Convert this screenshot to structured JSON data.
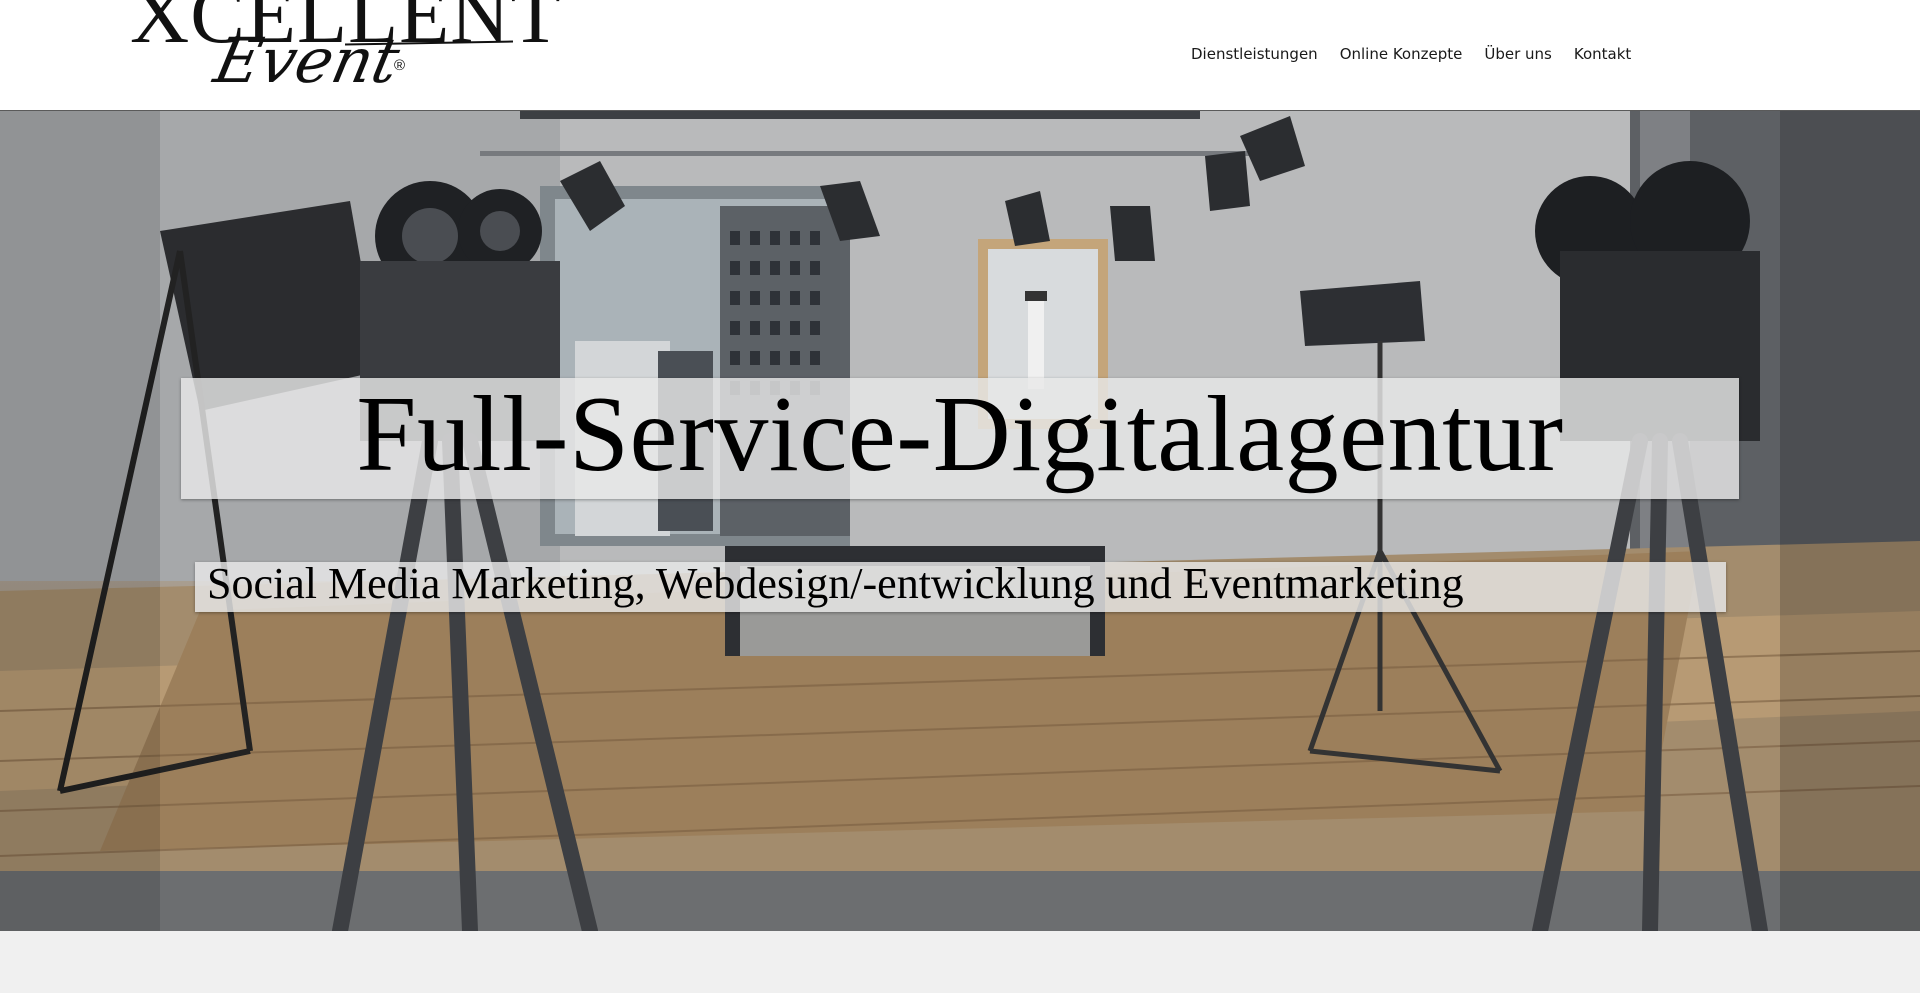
{
  "header": {
    "logo": {
      "wordmark": "XCELLENT",
      "script": "Event",
      "registered": "®"
    },
    "nav": [
      {
        "label": "Dienstleistungen"
      },
      {
        "label": "Online Konzepte"
      },
      {
        "label": "Über uns"
      },
      {
        "label": "Kontakt"
      }
    ]
  },
  "hero": {
    "title": "Full-Service-Digitalagentur",
    "subtitle": "Social Media Marketing, Webdesign/-entwicklung und Eventmarketing",
    "background_image": "film-studio-camera-room"
  },
  "colors": {
    "header_bg": "#ffffff",
    "text": "#000000",
    "text_box_bg": "#e8e8e8",
    "page_bg": "#f0f0f0"
  }
}
